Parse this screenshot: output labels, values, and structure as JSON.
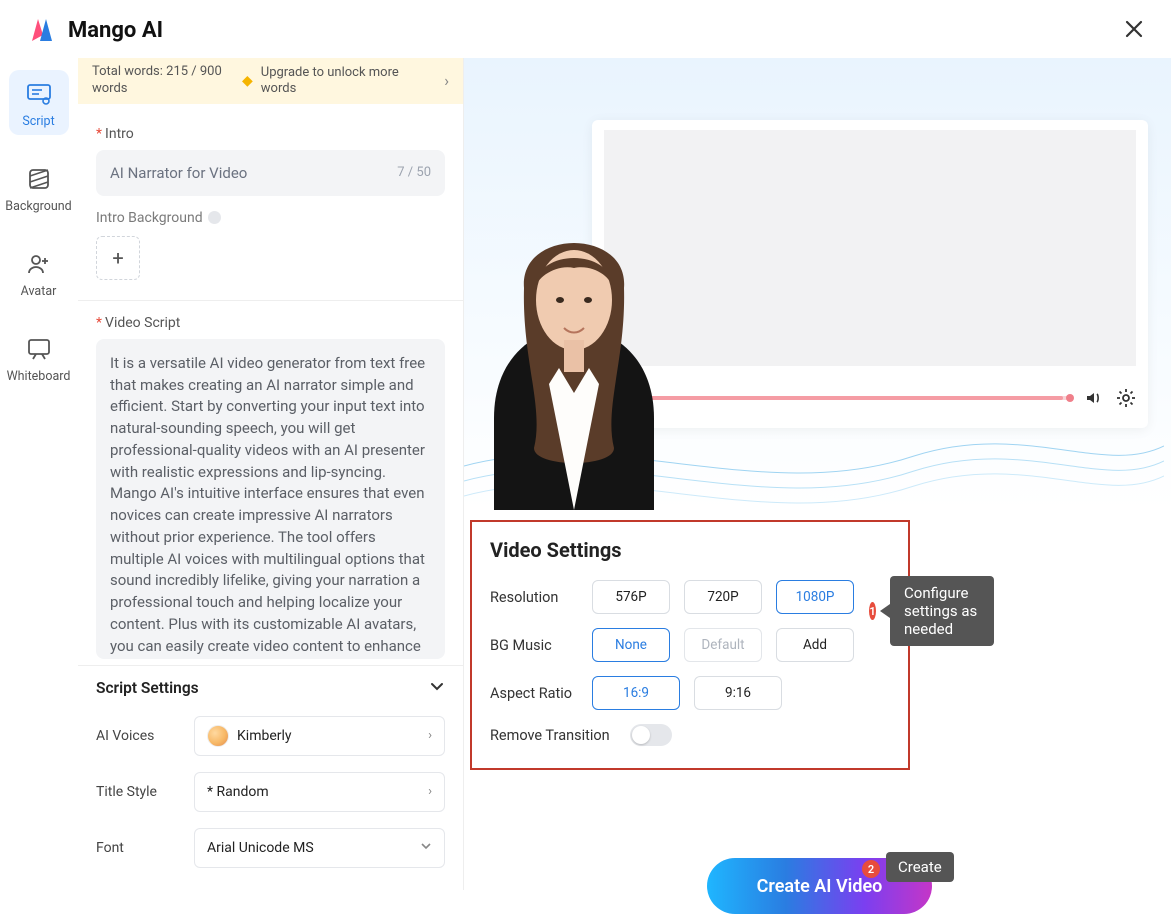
{
  "app": {
    "name": "Mango AI"
  },
  "sidebar": {
    "items": [
      {
        "label": "Script"
      },
      {
        "label": "Background"
      },
      {
        "label": "Avatar"
      },
      {
        "label": "Whiteboard"
      }
    ]
  },
  "wordbar": {
    "text": "Total words: 215 / 900 words",
    "upgrade": "Upgrade to unlock more words"
  },
  "intro": {
    "section_label": "Intro",
    "value": "AI Narrator for Video",
    "counter": "7 / 50",
    "bg_label": "Intro Background"
  },
  "script": {
    "section_label": "Video Script",
    "body": "It is a versatile AI video generator from text free that makes creating an AI narrator simple and efficient. Start by converting your input text into natural-sounding speech, you will get professional-quality videos with an AI presenter with realistic expressions and lip-syncing. Mango AI's intuitive interface ensures that even novices can create impressive AI narrators without prior experience. The tool offers multiple AI voices with multilingual options that sound incredibly lifelike, giving your narration a professional touch and helping localize your content. Plus with its customizable AI avatars, you can easily create video content to enhance visual appeal and interactivity."
  },
  "script_settings": {
    "title": "Script Settings",
    "voices_label": "AI Voices",
    "voice_value": "Kimberly",
    "title_style_label": "Title Style",
    "title_style_value": "* Random",
    "font_label": "Font",
    "font_value": "Arial Unicode MS"
  },
  "video_settings": {
    "title": "Video Settings",
    "resolution_label": "Resolution",
    "resolutions": [
      "576P",
      "720P",
      "1080P"
    ],
    "bgmusic_label": "BG Music",
    "bgmusic_options": [
      "None",
      "Default",
      "Add"
    ],
    "aspect_label": "Aspect Ratio",
    "aspects": [
      "16:9",
      "9:16"
    ],
    "remove_transition_label": "Remove Transition"
  },
  "annotations": {
    "a1_num": "1",
    "a1_text": "Configure settings as needed",
    "a2_num": "2",
    "a2_text": "Create"
  },
  "create_button": "Create AI Video"
}
